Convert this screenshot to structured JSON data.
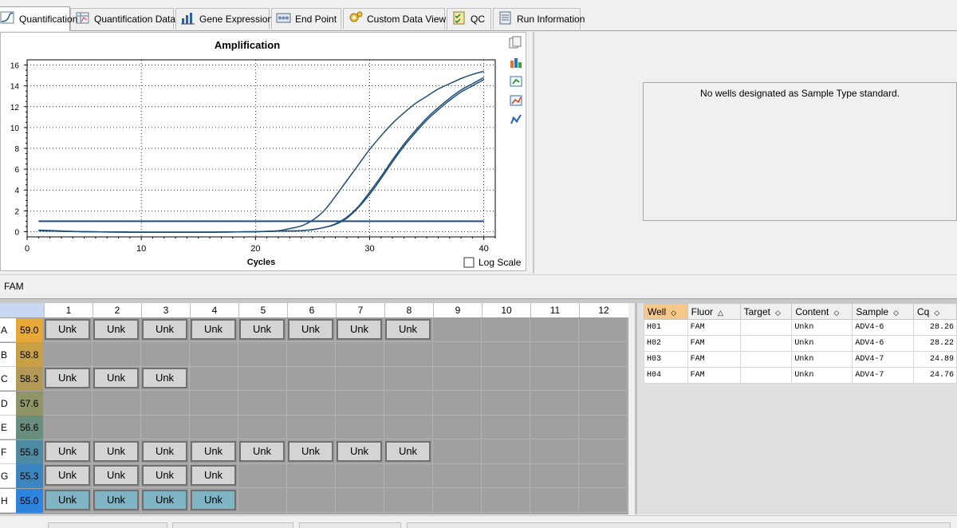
{
  "tabs": [
    {
      "label": "Quantification",
      "icon": "amplification-chart-icon"
    },
    {
      "label": "Quantification Data",
      "icon": "data-sheet-icon"
    },
    {
      "label": "Gene Expression",
      "icon": "bar-chart-icon"
    },
    {
      "label": "End Point",
      "icon": "end-point-icon"
    },
    {
      "label": "Custom Data View",
      "icon": "gear-cogs-icon"
    },
    {
      "label": "QC",
      "icon": "checklist-icon"
    },
    {
      "label": "Run Information",
      "icon": "run-info-icon"
    }
  ],
  "chart_data": {
    "type": "line",
    "title": "Amplification",
    "xlabel": "Cycles",
    "ylabel": "",
    "xlim": [
      0,
      41
    ],
    "ylim": [
      -0.5,
      16.5
    ],
    "xticks": [
      0,
      10,
      20,
      30,
      40
    ],
    "yticks": [
      0,
      2,
      4,
      6,
      8,
      10,
      12,
      14,
      16
    ],
    "grid": true,
    "series": [
      {
        "x": [
          1,
          5,
          10,
          15,
          20,
          22,
          23,
          24,
          25,
          26,
          27,
          28,
          29,
          30,
          31,
          32,
          33,
          34,
          35,
          36,
          37,
          38,
          39,
          40
        ],
        "y": [
          0.1,
          0.0,
          -0.05,
          -0.05,
          0.0,
          0.1,
          0.3,
          0.55,
          1.1,
          2.0,
          3.4,
          4.9,
          6.4,
          7.9,
          9.2,
          10.4,
          11.4,
          12.3,
          13.0,
          13.7,
          14.2,
          14.7,
          15.1,
          15.4
        ]
      },
      {
        "x": [
          1,
          5,
          10,
          15,
          20,
          22,
          24,
          25,
          26,
          27,
          28,
          29,
          30,
          31,
          32,
          33,
          34,
          35,
          36,
          37,
          38,
          39,
          40
        ],
        "y": [
          0.1,
          0.0,
          -0.05,
          -0.05,
          0.0,
          0.05,
          0.1,
          0.2,
          0.4,
          0.75,
          1.4,
          2.4,
          3.8,
          5.3,
          6.9,
          8.4,
          9.7,
          10.9,
          11.9,
          12.8,
          13.6,
          14.2,
          14.8
        ]
      },
      {
        "x": [
          1,
          5,
          10,
          15,
          20,
          22,
          24,
          25,
          26,
          27,
          28,
          29,
          30,
          31,
          32,
          33,
          34,
          35,
          36,
          37,
          38,
          39,
          40
        ],
        "y": [
          0.15,
          0.0,
          -0.05,
          -0.05,
          0.0,
          0.05,
          0.1,
          0.2,
          0.4,
          0.7,
          1.3,
          2.3,
          3.6,
          5.1,
          6.7,
          8.2,
          9.5,
          10.7,
          11.7,
          12.6,
          13.4,
          14.0,
          14.6
        ]
      },
      {
        "x": [
          1,
          40
        ],
        "y": [
          1.0,
          1.0
        ]
      }
    ]
  },
  "log_scale_label": "Log Scale",
  "log_scale_checked": false,
  "side_tools": [
    "copy-icon",
    "export-icon",
    "open-tool-icon",
    "chart-options-icon",
    "curve-icon"
  ],
  "standard_message": "No wells designated as Sample Type standard.",
  "fluor_label": "FAM",
  "plate": {
    "columns": [
      "1",
      "2",
      "3",
      "4",
      "5",
      "6",
      "7",
      "8",
      "9",
      "10",
      "11",
      "12"
    ],
    "rows": [
      {
        "label": "A",
        "temp": "59.0",
        "color": "#e7a83a",
        "wells": [
          "Unk",
          "Unk",
          "Unk",
          "Unk",
          "Unk",
          "Unk",
          "Unk",
          "Unk",
          "",
          "",
          "",
          ""
        ],
        "highlight": false
      },
      {
        "label": "B",
        "temp": "58.8",
        "color": "#c9a046",
        "wells": [
          "",
          "",
          "",
          "",
          "",
          "",
          "",
          "",
          "",
          "",
          "",
          ""
        ],
        "highlight": false
      },
      {
        "label": "C",
        "temp": "58.3",
        "color": "#b29a56",
        "wells": [
          "Unk",
          "Unk",
          "Unk",
          "",
          "",
          "",
          "",
          "",
          "",
          "",
          "",
          ""
        ],
        "highlight": false
      },
      {
        "label": "D",
        "temp": "57.6",
        "color": "#8e9466",
        "wells": [
          "",
          "",
          "",
          "",
          "",
          "",
          "",
          "",
          "",
          "",
          "",
          ""
        ],
        "highlight": false
      },
      {
        "label": "E",
        "temp": "56.6",
        "color": "#6a8e7e",
        "wells": [
          "",
          "",
          "",
          "",
          "",
          "",
          "",
          "",
          "",
          "",
          "",
          ""
        ],
        "highlight": false
      },
      {
        "label": "F",
        "temp": "55.8",
        "color": "#4e8aa2",
        "wells": [
          "Unk",
          "Unk",
          "Unk",
          "Unk",
          "Unk",
          "Unk",
          "Unk",
          "Unk",
          "",
          "",
          "",
          ""
        ],
        "highlight": false
      },
      {
        "label": "G",
        "temp": "55.3",
        "color": "#3c86c0",
        "wells": [
          "Unk",
          "Unk",
          "Unk",
          "Unk",
          "",
          "",
          "",
          "",
          "",
          "",
          "",
          ""
        ],
        "highlight": false
      },
      {
        "label": "H",
        "temp": "55.0",
        "color": "#2e84dc",
        "wells": [
          "Unk",
          "Unk",
          "Unk",
          "Unk",
          "",
          "",
          "",
          "",
          "",
          "",
          "",
          ""
        ],
        "highlight": true
      }
    ]
  },
  "results_table": {
    "headers": [
      "Well",
      "Fluor",
      "Target",
      "Content",
      "Sample",
      "Cq"
    ],
    "rows": [
      [
        "H01",
        "FAM",
        "",
        "Unkn",
        "ADV4-6",
        "28.26"
      ],
      [
        "H02",
        "FAM",
        "",
        "Unkn",
        "ADV4-6",
        "28.22"
      ],
      [
        "H03",
        "FAM",
        "",
        "Unkn",
        "ADV4-7",
        "24.89"
      ],
      [
        "H04",
        "FAM",
        "",
        "Unkn",
        "ADV4-7",
        "24.76"
      ]
    ]
  }
}
